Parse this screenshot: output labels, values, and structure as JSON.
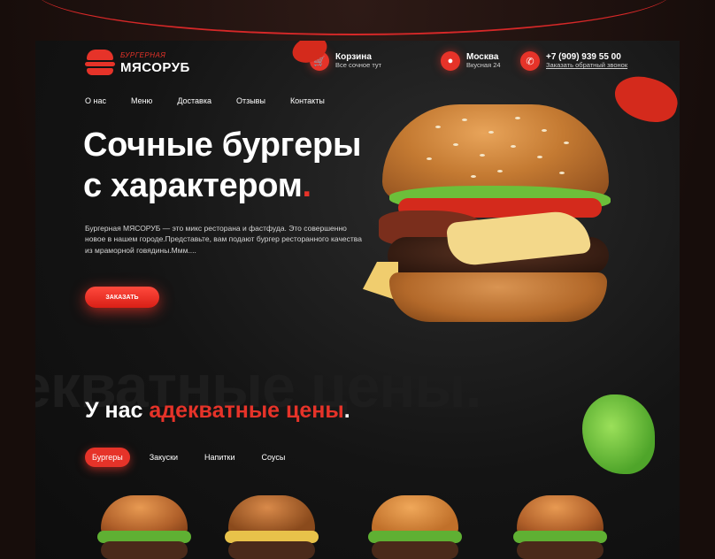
{
  "brand": {
    "sub": "БУРГЕРНАЯ",
    "name": "МЯСОРУБ"
  },
  "header": {
    "cart": {
      "title": "Корзина",
      "sub": "Все сочное тут",
      "icon": "cart-icon"
    },
    "city": {
      "title": "Москва",
      "sub": "Вкусная 24",
      "icon": "location-icon"
    },
    "phone": {
      "title": "+7 (909) 939 55 00",
      "sub": "Заказать обратный звонок",
      "icon": "phone-icon"
    }
  },
  "nav": [
    "О нас",
    "Меню",
    "Доставка",
    "Отзывы",
    "Контакты"
  ],
  "hero": {
    "line1": "Сочные бургеры",
    "line2": "с характером",
    "dot": ".",
    "description": "Бургерная  МЯСОРУБ — это микс ресторана и фастфуда. Это совершенно новое в нашем городе.Представьте, вам подают бургер ресторанного качества из мраморной говядины.Ммм....",
    "order_button": "ЗАКАЗАТЬ"
  },
  "section": {
    "bg_word": "екватные цены.",
    "title_prefix": "У нас ",
    "title_accent": "адекватные цены",
    "title_dot": "."
  },
  "tabs": [
    {
      "label": "Бургеры",
      "active": true
    },
    {
      "label": "Закуски",
      "active": false
    },
    {
      "label": "Напитки",
      "active": false
    },
    {
      "label": "Соусы",
      "active": false
    }
  ],
  "colors": {
    "accent": "#e63329",
    "background": "#111111"
  }
}
